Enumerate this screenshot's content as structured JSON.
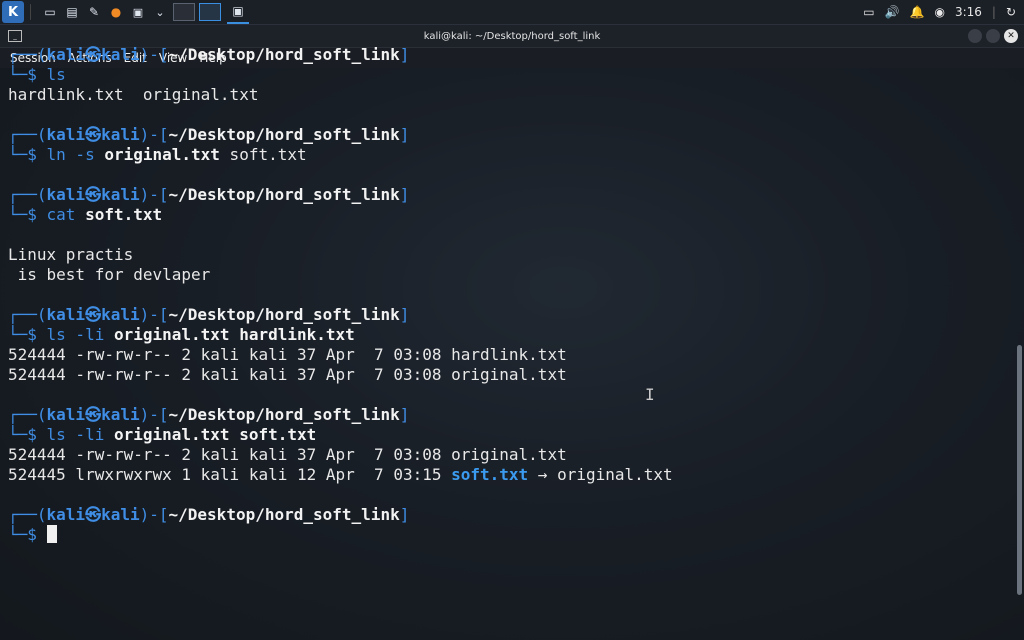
{
  "panel": {
    "launcher_icon": "kali-dragon-icon",
    "clock": "3:16"
  },
  "window": {
    "title": "kali@kali: ~/Desktop/hord_soft_link",
    "menu": [
      "Session",
      "Actions",
      "Edit",
      "View",
      "Help"
    ]
  },
  "prompt": {
    "top_open": "┌──(",
    "user": "kali",
    "at": "㉿",
    "host": "kali",
    "mid": ")-[",
    "path": "~/Desktop/hord_soft_link",
    "close": "]",
    "bottom": "└─$ "
  },
  "blocks": [
    {
      "cmd": "ls",
      "args": "",
      "output": [
        "hardlink.txt  original.txt",
        ""
      ]
    },
    {
      "cmd": "ln -s ",
      "args": "original.txt",
      "args_plain": " soft.txt",
      "output": [
        ""
      ]
    },
    {
      "cmd": "cat ",
      "args": "soft.txt",
      "output": [
        "",
        "Linux practis",
        " is best for devlaper",
        ""
      ]
    },
    {
      "cmd": "ls -li ",
      "args": "original.txt hardlink.txt",
      "output": [
        "524444 -rw-rw-r-- 2 kali kali 37 Apr  7 03:08 hardlink.txt",
        "524444 -rw-rw-r-- 2 kali kali 37 Apr  7 03:08 original.txt",
        ""
      ]
    },
    {
      "cmd": "ls -li ",
      "args": "original.txt soft.txt",
      "output": [
        "524444 -rw-rw-r-- 2 kali kali 37 Apr  7 03:08 original.txt"
      ]
    }
  ],
  "symlink_line": {
    "prefix": "524445 lrwxrwxrwx 1 kali kali 12 Apr  7 03:15 ",
    "name": "soft.txt",
    "arrow": " → ",
    "target": "original.txt"
  }
}
